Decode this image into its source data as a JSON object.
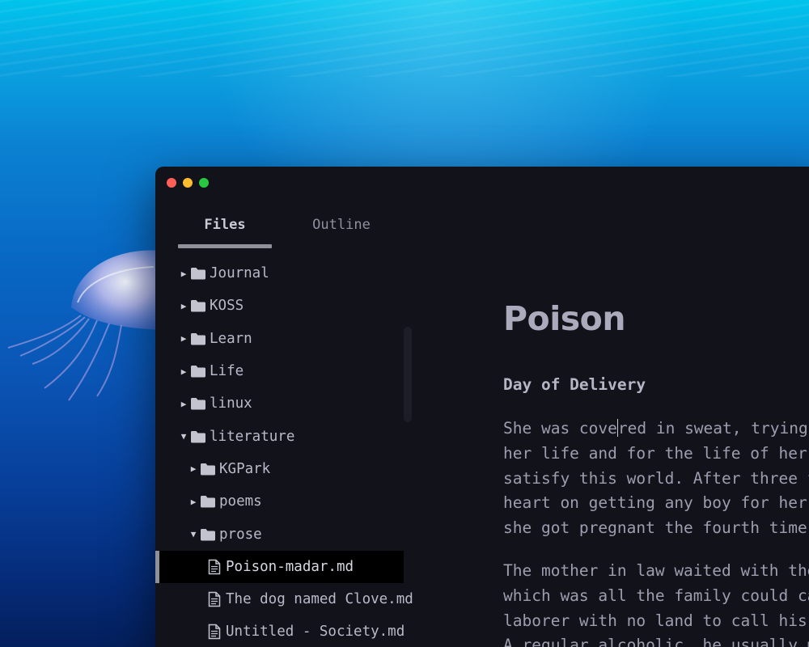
{
  "window": {
    "traffic_lights": [
      {
        "name": "close",
        "color": "#ff5f57"
      },
      {
        "name": "minimize",
        "color": "#febc2e"
      },
      {
        "name": "zoom",
        "color": "#28c840"
      }
    ]
  },
  "sidebar": {
    "tabs": [
      {
        "label": "Files",
        "active": true
      },
      {
        "label": "Outline",
        "active": false
      }
    ],
    "tree": [
      {
        "label": "Journal",
        "type": "folder",
        "expanded": false,
        "depth": 0
      },
      {
        "label": "KOSS",
        "type": "folder",
        "expanded": false,
        "depth": 0
      },
      {
        "label": "Learn",
        "type": "folder",
        "expanded": false,
        "depth": 0
      },
      {
        "label": "Life",
        "type": "folder",
        "expanded": false,
        "depth": 0
      },
      {
        "label": "linux",
        "type": "folder",
        "expanded": false,
        "depth": 0
      },
      {
        "label": "literature",
        "type": "folder",
        "expanded": true,
        "depth": 0
      },
      {
        "label": "KGPark",
        "type": "folder",
        "expanded": false,
        "depth": 1
      },
      {
        "label": "poems",
        "type": "folder",
        "expanded": false,
        "depth": 1
      },
      {
        "label": "prose",
        "type": "folder",
        "expanded": true,
        "depth": 1
      },
      {
        "label": "Poison-madar.md",
        "type": "file",
        "depth": 2,
        "selected": true
      },
      {
        "label": "The dog named Clove.md",
        "type": "file",
        "depth": 2
      },
      {
        "label": "Untitled - Society.md",
        "type": "file",
        "depth": 2
      }
    ]
  },
  "editor": {
    "title": "Poison",
    "heading": "Day of Delivery",
    "para1_before_caret": "She was cove",
    "para1_after_caret": "red in sweat, trying as",
    "para1_lines": [
      "her life and for the life of her ch",
      "satisfy this world. After three fai",
      "heart on getting any boy for her fa",
      "she got pregnant the fourth time."
    ],
    "para2_lines": [
      "The mother in law waited with the t",
      "which was all the family could call",
      "laborer with no land to call his ow",
      "A regular alcoholic, he usually mad"
    ]
  },
  "colors": {
    "window_bg": "#12131a",
    "selected_row_bg": "#000000",
    "text": "#9c9eb0",
    "accent_bar": "#8f909a"
  }
}
